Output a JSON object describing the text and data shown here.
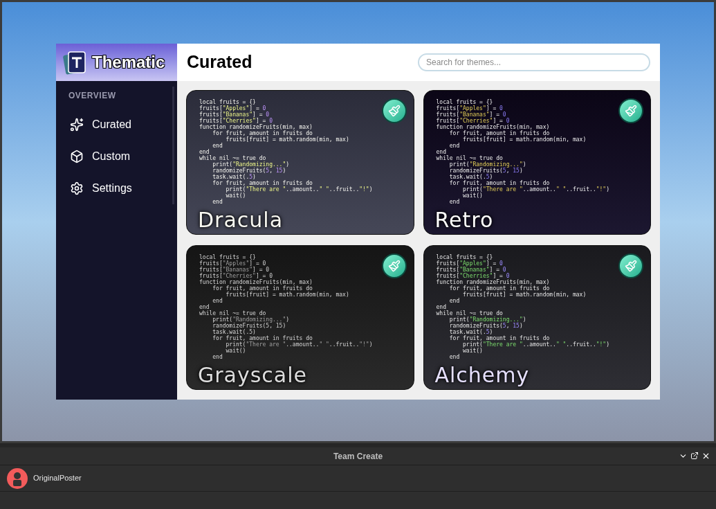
{
  "plugin": {
    "brand": "Thematic",
    "page_title": "Curated",
    "search": {
      "placeholder": "Search for themes..."
    },
    "sidebar": {
      "section": "OVERVIEW",
      "items": [
        {
          "label": "Curated"
        },
        {
          "label": "Custom"
        },
        {
          "label": "Settings"
        }
      ]
    },
    "themes": [
      {
        "name": "Dracula",
        "kind": "dracula",
        "code": [
          "local fruits = {}",
          "fruits[\"Apples\"] = 0",
          "fruits[\"Bananas\"] = 0",
          "fruits[\"Cherries\"] = 0",
          "function randomizeFruits(min, max)",
          "    for fruit, amount in fruits do",
          "        fruits[fruit] = math.random(min, max)",
          "    end",
          "end",
          "while nil ~= true do",
          "    print(\"Randomizing...\")",
          "    randomizeFruits(5, 15)",
          "    task.wait(.5)",
          "    for fruit, amount in fruits do",
          "        print(\"There are \"..amount..\" \"..fruit..\"!\")",
          "        wait()",
          "    end"
        ]
      },
      {
        "name": "Retro",
        "kind": "retro",
        "code": [
          "local fruits = {}",
          "fruits[\"Apples\"] = 0",
          "fruits[\"Bananas\"] = 0",
          "fruits[\"Cherries\"] = 0",
          "function randomizeFruits(min, max)",
          "    for fruit, amount in fruits do",
          "        fruits[fruit] = math.random(min, max)",
          "    end",
          "end",
          "while nil ~= true do",
          "    print(\"Randomizing...\")",
          "    randomizeFruits(5, 15)",
          "    task.wait(.5)",
          "    for fruit, amount in fruits do",
          "        print(\"There are \"..amount..\" \"..fruit..\"!\")",
          "        wait()",
          "    end"
        ]
      },
      {
        "name": "Grayscale",
        "kind": "grayscale",
        "code": [
          "local fruits = {}",
          "fruits[\"Apples\"] = 0",
          "fruits[\"Bananas\"] = 0",
          "fruits[\"Cherries\"] = 0",
          "function randomizeFruits(min, max)",
          "    for fruit, amount in fruits do",
          "        fruits[fruit] = math.random(min, max)",
          "    end",
          "end",
          "while nil ~= true do",
          "    print(\"Randomizing...\")",
          "    randomizeFruits(5, 15)",
          "    task.wait(.5)",
          "    for fruit, amount in fruits do",
          "        print(\"There are \"..amount..\" \"..fruit..\"!\")",
          "        wait()",
          "    end"
        ]
      },
      {
        "name": "Alchemy",
        "kind": "alchemy",
        "code": [
          "local fruits = {}",
          "fruits[\"Apples\"] = 0",
          "fruits[\"Bananas\"] = 0",
          "fruits[\"Cherries\"] = 0",
          "function randomizeFruits(min, max)",
          "    for fruit, amount in fruits do",
          "        fruits[fruit] = math.random(min, max)",
          "    end",
          "end",
          "while nil ~= true do",
          "    print(\"Randomizing...\")",
          "    randomizeFruits(5, 15)",
          "    task.wait(.5)",
          "    for fruit, amount in fruits do",
          "        print(\"There are \"..amount..\" \"..fruit..\"!\")",
          "        wait()",
          "    end"
        ]
      }
    ]
  },
  "team_create": {
    "title": "Team Create",
    "users": [
      {
        "name": "OriginalPoster"
      }
    ]
  }
}
